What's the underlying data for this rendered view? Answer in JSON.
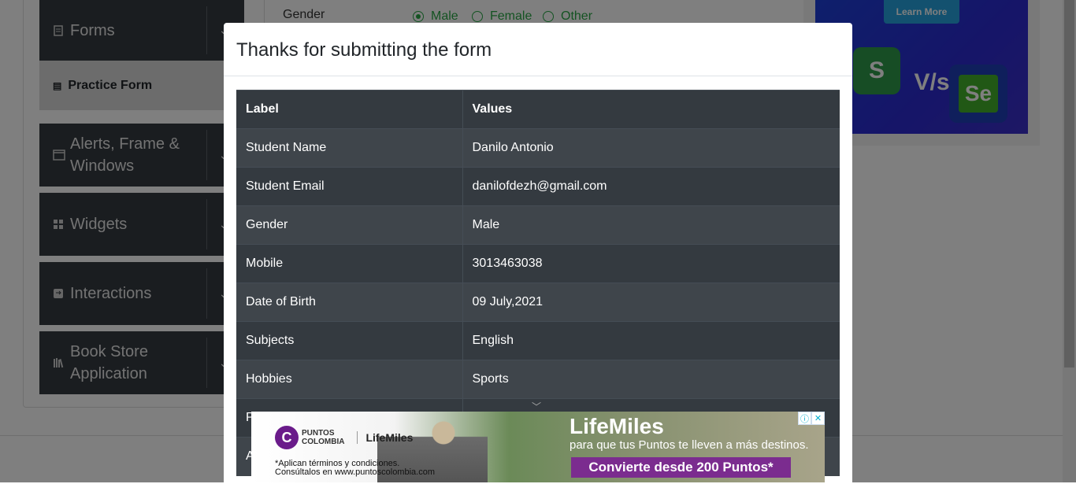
{
  "background": {
    "sidebar": {
      "groups": [
        {
          "label": "Forms",
          "icon": "form-icon"
        },
        {
          "label": "Alerts, Frame & Windows",
          "icon": "window-icon"
        },
        {
          "label": "Widgets",
          "icon": "widgets-icon"
        },
        {
          "label": "Interactions",
          "icon": "interactions-icon"
        },
        {
          "label": "Book Store Application",
          "icon": "books-icon"
        }
      ],
      "active_item": "Practice Form"
    },
    "form": {
      "gender_label": "Gender",
      "gender_options": [
        "Male",
        "Female",
        "Other"
      ],
      "gender_selected": "Male"
    },
    "side_ad": {
      "button": "Learn More",
      "logo_left": "S",
      "vs": "V/s",
      "logo_right": "Se"
    }
  },
  "modal": {
    "title": "Thanks for submitting the form",
    "table": {
      "headers": [
        "Label",
        "Values"
      ],
      "rows": [
        {
          "label": "Student Name",
          "value": "Danilo Antonio"
        },
        {
          "label": "Student Email",
          "value": "danilofdezh@gmail.com"
        },
        {
          "label": "Gender",
          "value": "Male"
        },
        {
          "label": "Mobile",
          "value": "3013463038"
        },
        {
          "label": "Date of Birth",
          "value": "09 July,2021"
        },
        {
          "label": "Subjects",
          "value": "English"
        },
        {
          "label": "Hobbies",
          "value": "Sports"
        },
        {
          "label": "P",
          "value": ""
        },
        {
          "label": "A",
          "value": ""
        }
      ]
    }
  },
  "bottom_ad": {
    "brand_logo_letter": "C",
    "brand_line1": "PUNTOS",
    "brand_line2": "COLOMBIA",
    "partner": "LifeMiles",
    "fine_print_1": "*Aplican términos y condiciones.",
    "fine_print_2": "Consúltalos en www.puntoscolombia.com",
    "headline": "LifeMiles",
    "subheadline": "para que tus Puntos te lleven a más destinos.",
    "cta": "Convierte desde 200 Puntos*",
    "info_glyph": "ⓘ",
    "close_glyph": "✕"
  },
  "colors": {
    "accent_green": "#28a745",
    "table_dark": "#343a40",
    "overlay": "rgba(0,0,0,0.5)",
    "ad_purple": "#7b2c8f"
  }
}
